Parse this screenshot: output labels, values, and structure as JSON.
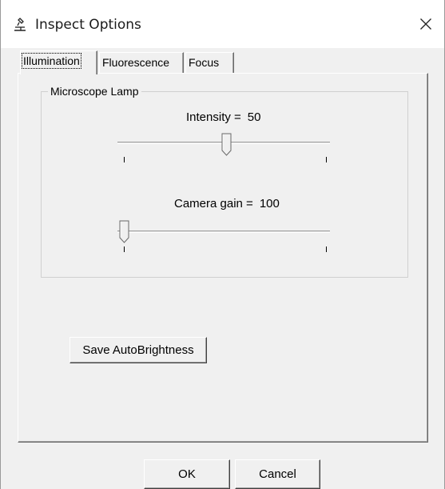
{
  "window": {
    "title": "Inspect Options",
    "icon": "microscope-icon",
    "close_icon": "close-icon"
  },
  "tabs": [
    {
      "label": "Illumination",
      "active": true
    },
    {
      "label": "Fluorescence",
      "active": false
    },
    {
      "label": "Focus",
      "active": false
    }
  ],
  "group": {
    "label": "Microscope Lamp"
  },
  "sliders": {
    "intensity": {
      "label": "Intensity =",
      "value": "50",
      "level_fraction": 0.5
    },
    "camera_gain": {
      "label": "Camera gain =",
      "value": "100",
      "level_fraction": 0.0
    }
  },
  "buttons": {
    "save_autobrightness": "Save AutoBrightness",
    "ok": "OK",
    "cancel": "Cancel"
  }
}
